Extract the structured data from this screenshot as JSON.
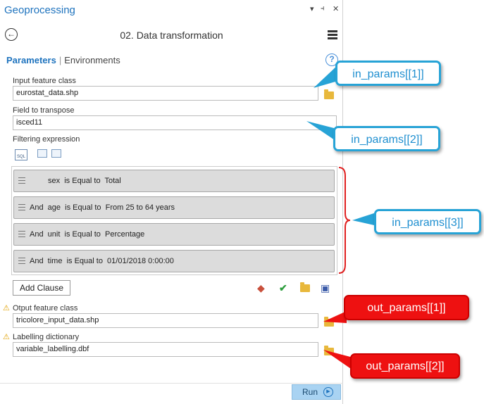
{
  "panel": {
    "title": "Geoprocessing",
    "controls": [
      "▾",
      "⫞",
      "✕"
    ],
    "tool_title": "02. Data transformation",
    "tabs": {
      "active": "Parameters",
      "separator": "|",
      "other": "Environments"
    },
    "help_glyph": "?"
  },
  "params": {
    "input_feature_class": {
      "label": "Input feature class",
      "value": "eurostat_data.shp"
    },
    "field_to_transpose": {
      "label": "Field to transpose",
      "value": "isced11"
    },
    "filtering_expression": {
      "label": "Filtering expression",
      "sql_icon_text": "SQL"
    },
    "clauses": [
      "sex  is Equal to  Total",
      "And  age  is Equal to  From 25 to 64 years",
      "And  unit  is Equal to  Percentage",
      "And  time  is Equal to  01/01/2018 0:00:00"
    ],
    "add_clause_label": "Add Clause",
    "output_feature_class": {
      "label": "Otput feature class",
      "value": "tricolore_input_data.shp"
    },
    "labelling_dictionary": {
      "label": "Labelling dictionary",
      "value": "variable_labelling.dbf"
    },
    "run_label": "Run"
  },
  "annotations": {
    "in1": "in_params[[1]]",
    "in2": "in_params[[2]]",
    "in3": "in_params[[3]]",
    "out1": "out_params[[1]]",
    "out2": "out_params[[2]]"
  },
  "colors": {
    "accent": "#1e73be",
    "callout_blue": "#27a3d6",
    "callout_red": "#ee1111",
    "bracket": "#e02020"
  }
}
